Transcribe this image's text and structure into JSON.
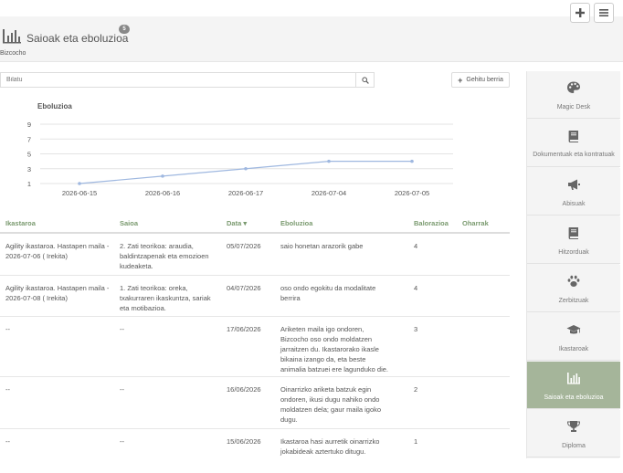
{
  "header": {
    "title": "Saioak eta eboluzioa",
    "count_badge": "5",
    "subtitle": "Bizcocho"
  },
  "toolbar": {
    "search_placeholder": "Bilatu",
    "add_label": "Gehitu berria"
  },
  "chart_data": {
    "type": "line",
    "title": "Eboluzioa",
    "categories": [
      "2026-06-15",
      "2026-06-16",
      "2026-06-17",
      "2026-07-04",
      "2026-07-05"
    ],
    "values": [
      1,
      2,
      3,
      4,
      4
    ],
    "y_ticks": [
      "9",
      "7",
      "5",
      "3",
      "1"
    ],
    "ylim": [
      1,
      9
    ],
    "grid": true,
    "color": "#9fb8e0"
  },
  "table": {
    "columns": [
      "Ikastaroa",
      "Saioa",
      "Data",
      "Eboluzioa",
      "Balorazioa",
      "Oharrak"
    ],
    "sort_indicator": "▾",
    "rows": [
      {
        "course": "Agility ikastaroa. Hastapen maila - 2026-07-06 ( Irekita)",
        "session": "2. Zati teorikoa: araudia, baldintzapenak eta emozioen kudeaketa.",
        "date": "05/07/2026",
        "evolution": "saio honetan arazorik gabe",
        "rating": "4",
        "notes": ""
      },
      {
        "course": "Agility ikastaroa. Hastapen maila - 2026-07-08 ( Irekita)",
        "session": "1. Zati teorikoa: oreka, txakurraren ikaskuntza, sariak eta motibazioa.",
        "date": "04/07/2026",
        "evolution": "oso ondo egokitu da modalitate berrira",
        "rating": "4",
        "notes": ""
      },
      {
        "course": "--",
        "session": "--",
        "date": "17/06/2026",
        "evolution": "Ariketen maila igo ondoren, Bizcocho oso ondo moldatzen jarraitzen du. Ikastarorako ikasle bikaina izango da, eta beste animalia batzuei ere lagunduko die.",
        "rating": "3",
        "notes": ""
      },
      {
        "course": "--",
        "session": "--",
        "date": "16/06/2026",
        "evolution": "Oinarrizko ariketa batzuk egin ondoren, ikusi dugu nahiko ondo moldatzen dela; gaur maila igoko dugu.",
        "rating": "2",
        "notes": ""
      },
      {
        "course": "--",
        "session": "--",
        "date": "15/06/2026",
        "evolution": "Ikastaroa hasi aurretik oinarrizko jokabideak aztertuko ditugu.",
        "rating": "1",
        "notes": ""
      }
    ]
  },
  "sidebar": {
    "items": [
      {
        "label": "Magic Desk",
        "icon": "palette-icon"
      },
      {
        "label": "Dokumentuak eta kontratuak",
        "icon": "book-icon"
      },
      {
        "label": "Abisuak",
        "icon": "megaphone-icon"
      },
      {
        "label": "Hitzorduak",
        "icon": "book-icon"
      },
      {
        "label": "Zerbitzuak",
        "icon": "paw-icon"
      },
      {
        "label": "Ikastaroak",
        "icon": "graduation-cap-icon"
      },
      {
        "label": "Saioak eta eboluzioa",
        "icon": "bar-chart-icon"
      },
      {
        "label": "Diploma",
        "icon": "trophy-icon"
      }
    ],
    "active_index": 6,
    "active_color": "#a5b59a"
  }
}
